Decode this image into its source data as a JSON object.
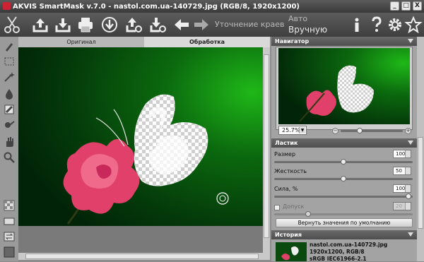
{
  "window": {
    "title": "AKVIS SmartMask v.7.0 - nastol.com.ua-140729.jpg (RGB/8, 1920x1200)",
    "minimize": "_",
    "maximize": "□",
    "close": "X"
  },
  "toolbar": {
    "edge_refine": "Уточнение краев",
    "mode_auto": "Авто",
    "mode_manual": "Вручную"
  },
  "tabs": {
    "original": "Оригинал",
    "processing": "Обработка"
  },
  "navigator": {
    "title": "Навигатор",
    "zoom": "25.7%"
  },
  "eraser": {
    "title": "Ластик",
    "size_label": "Размер",
    "size_value": "100",
    "hardness_label": "Жесткость",
    "hardness_value": "50",
    "strength_label": "Сила, %",
    "strength_value": "100",
    "tolerance_label": "Допуск",
    "tolerance_value": "20",
    "reset_label": "Вернуть значения по умолчанию"
  },
  "history": {
    "title": "История",
    "filename": "nastol.com.ua-140729.jpg",
    "info1": "1920x1200, RGB/8",
    "info2": "sRGB IEC61966-2.1"
  },
  "colors": {
    "toolbar_bg": "#4a4a4a",
    "panel_bg": "#a3a3a3",
    "accent_green": "#0f8a0a",
    "flower_pink": "#e0406a"
  }
}
